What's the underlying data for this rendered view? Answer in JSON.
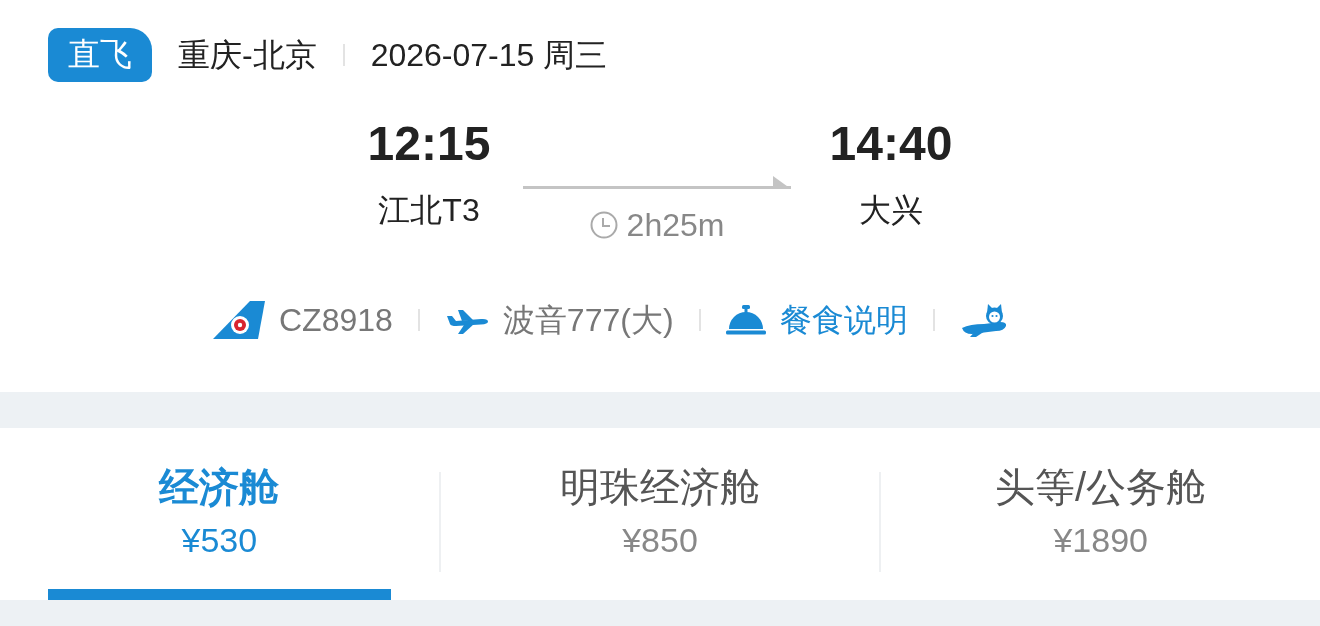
{
  "header": {
    "badge": "直飞",
    "route": "重庆-北京",
    "date": "2026-07-15 周三"
  },
  "flight": {
    "departure": {
      "time": "12:15",
      "airport": "江北T3"
    },
    "duration": "2h25m",
    "arrival": {
      "time": "14:40",
      "airport": "大兴"
    }
  },
  "info": [
    {
      "kind": "airline",
      "text": "CZ8918"
    },
    {
      "kind": "aircraft",
      "text": "波音777(大)"
    },
    {
      "kind": "meal",
      "text": "餐食说明"
    },
    {
      "kind": "mascot"
    }
  ],
  "cabin_tabs": [
    {
      "label": "经济舱",
      "price": "¥530",
      "selected": true
    },
    {
      "label": "明珠经济舱",
      "price": "¥850",
      "selected": false
    },
    {
      "label": "头等/公务舱",
      "price": "¥1890",
      "selected": false
    }
  ]
}
